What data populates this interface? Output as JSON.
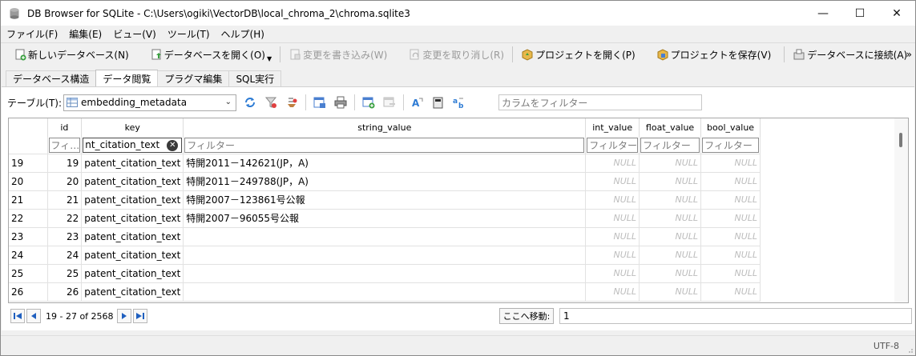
{
  "window": {
    "title": "DB Browser for SQLite - C:\\Users\\ogiki\\VectorDB\\local_chroma_2\\chroma.sqlite3",
    "minimize": "—",
    "maximize": "☐",
    "close": "✕"
  },
  "menu": [
    "ファイル(F)",
    "編集(E)",
    "ビュー(V)",
    "ツール(T)",
    "ヘルプ(H)"
  ],
  "toolbar": {
    "new_db": "新しいデータベース(N)",
    "open_db": "データベースを開く(O)",
    "write_changes": "変更を書き込み(W)",
    "revert_changes": "変更を取り消し(R)",
    "open_project": "プロジェクトを開く(P)",
    "save_project": "プロジェクトを保存(V)",
    "attach_db": "データベースに接続(A)",
    "overflow": "»"
  },
  "tabs": [
    "データベース構造",
    "データ閲覧",
    "プラグマ編集",
    "SQL実行"
  ],
  "active_tab": 1,
  "browse": {
    "table_label": "テーブル(T):",
    "table_value": "embedding_metadata",
    "column_filter_placeholder": "カラムをフィルター"
  },
  "grid": {
    "columns": [
      "id",
      "key",
      "string_value",
      "int_value",
      "float_value",
      "bool_value"
    ],
    "filters": [
      "フィ…",
      "nt_citation_text",
      "フィルター",
      "フィルター",
      "フィルター",
      "フィルター"
    ],
    "rows": [
      {
        "row": "19",
        "id": "19",
        "key": "patent_citation_text",
        "string_value": "特開2011－142621(JP，A)",
        "int_value": "NULL",
        "float_value": "NULL",
        "bool_value": "NULL"
      },
      {
        "row": "20",
        "id": "20",
        "key": "patent_citation_text",
        "string_value": "特開2011－249788(JP，A)",
        "int_value": "NULL",
        "float_value": "NULL",
        "bool_value": "NULL"
      },
      {
        "row": "21",
        "id": "21",
        "key": "patent_citation_text",
        "string_value": "特開2007－123861号公報",
        "int_value": "NULL",
        "float_value": "NULL",
        "bool_value": "NULL"
      },
      {
        "row": "22",
        "id": "22",
        "key": "patent_citation_text",
        "string_value": "特開2007－96055号公報",
        "int_value": "NULL",
        "float_value": "NULL",
        "bool_value": "NULL"
      },
      {
        "row": "23",
        "id": "23",
        "key": "patent_citation_text",
        "string_value": "",
        "int_value": "NULL",
        "float_value": "NULL",
        "bool_value": "NULL"
      },
      {
        "row": "24",
        "id": "24",
        "key": "patent_citation_text",
        "string_value": "",
        "int_value": "NULL",
        "float_value": "NULL",
        "bool_value": "NULL"
      },
      {
        "row": "25",
        "id": "25",
        "key": "patent_citation_text",
        "string_value": "",
        "int_value": "NULL",
        "float_value": "NULL",
        "bool_value": "NULL"
      },
      {
        "row": "26",
        "id": "26",
        "key": "patent_citation_text",
        "string_value": "",
        "int_value": "NULL",
        "float_value": "NULL",
        "bool_value": "NULL"
      }
    ]
  },
  "nav": {
    "record_range": "19 - 27 of 2568",
    "goto_label": "ここへ移動:",
    "goto_value": "1"
  },
  "status": {
    "encoding": "UTF-8"
  }
}
